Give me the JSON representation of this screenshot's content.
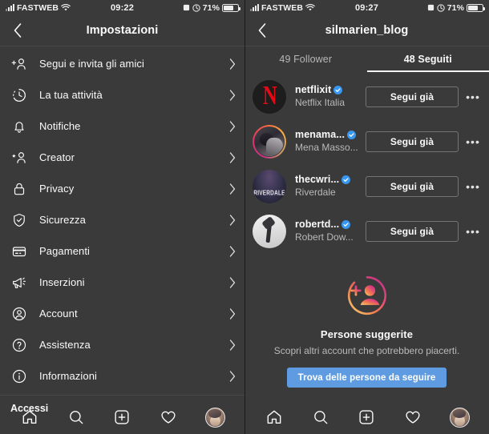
{
  "colors": {
    "background": "#3b3b3b",
    "text_primary": "#fafafa",
    "text_secondary": "#b9b9b9",
    "accent_blue": "#5f9be0",
    "verified_blue": "#3897f0",
    "netflix_red": "#e50914"
  },
  "left_panel": {
    "status_bar": {
      "carrier": "FASTWEB",
      "time": "09:22",
      "battery_percent": "71%"
    },
    "nav": {
      "back_icon": "chevron-left-icon",
      "title": "Impostazioni"
    },
    "menu_items": [
      {
        "icon": "person-add-icon",
        "label": "Segui e invita gli amici"
      },
      {
        "icon": "clock-activity-icon",
        "label": "La tua attività"
      },
      {
        "icon": "bell-icon",
        "label": "Notifiche"
      },
      {
        "icon": "creator-star-person-icon",
        "label": "Creator"
      },
      {
        "icon": "lock-icon",
        "label": "Privacy"
      },
      {
        "icon": "shield-check-icon",
        "label": "Sicurezza"
      },
      {
        "icon": "credit-card-icon",
        "label": "Pagamenti"
      },
      {
        "icon": "megaphone-icon",
        "label": "Inserzioni"
      },
      {
        "icon": "account-circle-icon",
        "label": "Account"
      },
      {
        "icon": "question-circle-icon",
        "label": "Assistenza"
      },
      {
        "icon": "info-circle-icon",
        "label": "Informazioni"
      }
    ],
    "section_footer_label": "Accessi",
    "tabbar": [
      {
        "icon": "home-icon",
        "name": "home"
      },
      {
        "icon": "search-icon",
        "name": "search"
      },
      {
        "icon": "plus-box-icon",
        "name": "create"
      },
      {
        "icon": "heart-icon",
        "name": "activity"
      },
      {
        "icon": "avatar-icon",
        "name": "profile"
      }
    ]
  },
  "right_panel": {
    "status_bar": {
      "carrier": "FASTWEB",
      "time": "09:27",
      "battery_percent": "71%"
    },
    "nav": {
      "back_icon": "chevron-left-icon",
      "title": "silmarien_blog"
    },
    "tabs": [
      {
        "label": "49 Follower",
        "active": false
      },
      {
        "label": "48 Seguiti",
        "active": true
      }
    ],
    "users": [
      {
        "username": "netflixit",
        "fullname": "Netflix Italia",
        "verified": true,
        "button_label": "Segui già",
        "has_story_ring": false,
        "avatar_kind": "netflix"
      },
      {
        "username": "menama...",
        "fullname": "Mena Masso...",
        "verified": true,
        "button_label": "Segui già",
        "has_story_ring": true,
        "avatar_kind": "mena"
      },
      {
        "username": "thecwri...",
        "fullname": "Riverdale",
        "verified": true,
        "button_label": "Segui già",
        "has_story_ring": false,
        "avatar_kind": "riverdale",
        "avatar_text": "RIVERDALE"
      },
      {
        "username": "robertd...",
        "fullname": "Robert Dow...",
        "verified": true,
        "button_label": "Segui già",
        "has_story_ring": false,
        "avatar_kind": "rdj"
      }
    ],
    "more_glyph": "•••",
    "suggested": {
      "icon": "person-add-gradient-icon",
      "title": "Persone suggerite",
      "subtitle": "Scopri altri account che potrebbero piacerti.",
      "cta_label": "Trova delle persone da seguire"
    },
    "tabbar": [
      {
        "icon": "home-icon",
        "name": "home"
      },
      {
        "icon": "search-icon",
        "name": "search"
      },
      {
        "icon": "plus-box-icon",
        "name": "create"
      },
      {
        "icon": "heart-icon",
        "name": "activity"
      },
      {
        "icon": "avatar-icon",
        "name": "profile"
      }
    ]
  }
}
